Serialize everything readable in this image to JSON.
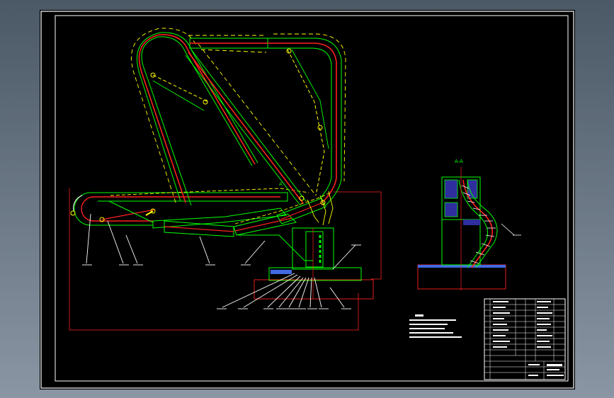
{
  "drawing": {
    "colors": {
      "background": "#000000",
      "frame": "#ffffff",
      "outline": "#00ff00",
      "pipe": "#ff2020",
      "hidden": "#ffff00",
      "hatch": "#ffffff",
      "section_block": "#2e2e9e",
      "ground": "#4169e1",
      "center": "#ff2020"
    },
    "section_title": "A-A",
    "view_marker": "A"
  }
}
